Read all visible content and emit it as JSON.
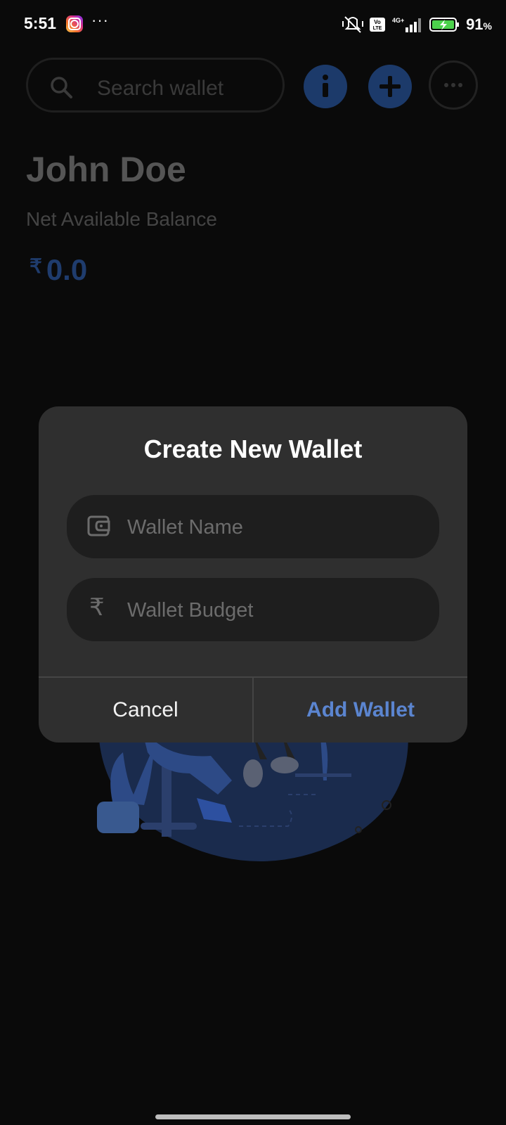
{
  "status_bar": {
    "time": "5:51",
    "more": "···",
    "battery_percent": "91",
    "battery_unit": "%",
    "icons": [
      "instagram-icon",
      "mute-vibrate-icon",
      "volte-icon",
      "4g-plus-icon",
      "signal-icon",
      "battery-charging-icon"
    ]
  },
  "header": {
    "search_placeholder": "Search wallet"
  },
  "profile": {
    "name": "John Doe",
    "balance_label": "Net Available Balance",
    "currency_symbol": "₹",
    "balance_value": "0.0"
  },
  "dialog": {
    "title": "Create New Wallet",
    "wallet_name_placeholder": "Wallet Name",
    "wallet_budget_placeholder": "Wallet Budget",
    "budget_symbol": "₹",
    "cancel_label": "Cancel",
    "add_label": "Add Wallet"
  },
  "colors": {
    "accent": "#5b85d0",
    "dialog_bg": "#2f2f2f",
    "field_bg": "#1e1e1e",
    "screen_bg": "#0a0a0a"
  }
}
